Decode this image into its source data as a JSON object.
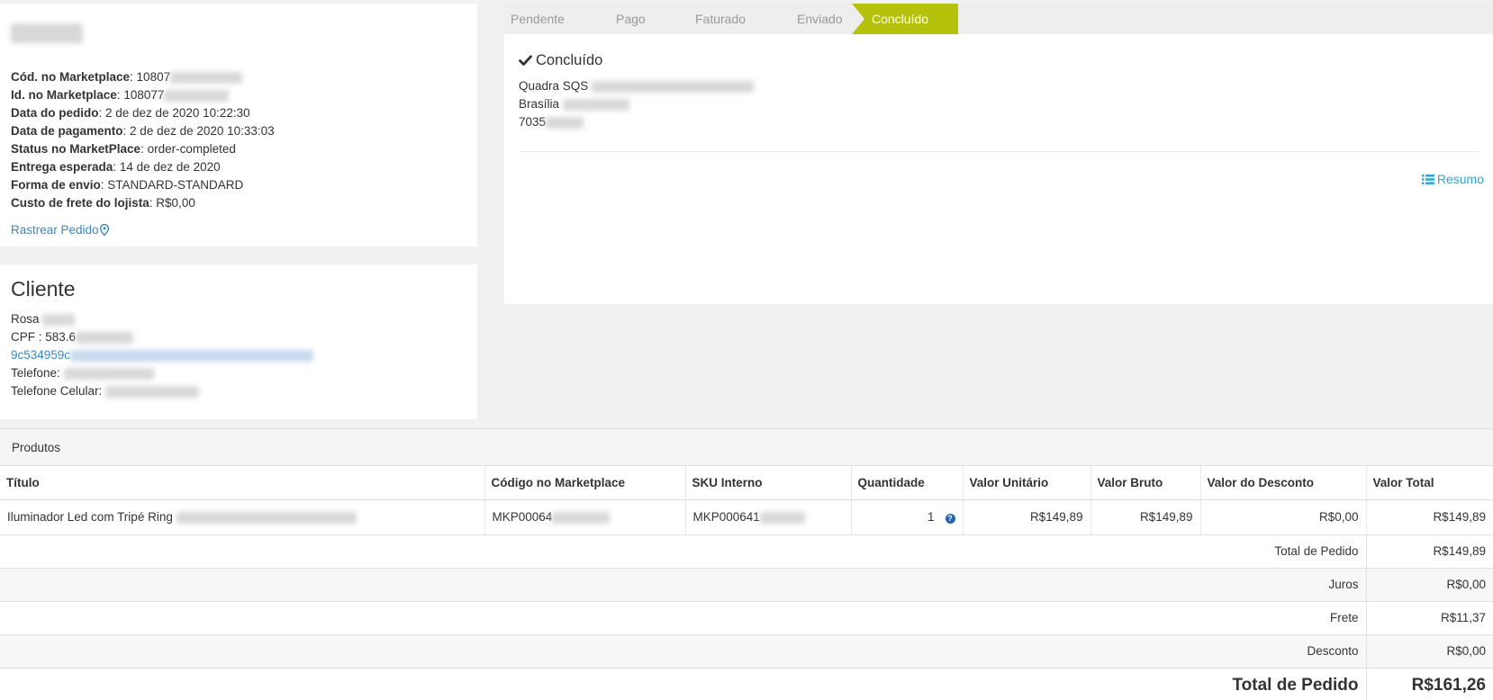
{
  "store": {
    "fields": [
      {
        "label": "Cód. no Marketplace",
        "value": "10807"
      },
      {
        "label": "Id. no Marketplace",
        "value": "108077"
      },
      {
        "label": "Data do pedido",
        "value": "2 de dez de 2020 10:22:30"
      },
      {
        "label": "Data de pagamento",
        "value": "2 de dez de 2020 10:33:03"
      },
      {
        "label": "Status no MarketPlace",
        "value": "order-completed"
      },
      {
        "label": "Entrega esperada",
        "value": "14 de dez de 2020"
      },
      {
        "label": "Forma de envio",
        "value": "STANDARD-STANDARD"
      },
      {
        "label": "Custo de frete do lojista",
        "value": "R$0,00"
      }
    ],
    "track_link": "Rastrear Pedido"
  },
  "client": {
    "title": "Cliente",
    "name": "Rosa",
    "cpf": "CPF : 583.6",
    "email": "9c534959c",
    "phone_label": "Telefone:",
    "mobile_label": "Telefone Celular:"
  },
  "status": {
    "steps": [
      "Pendente",
      "Pago",
      "Faturado",
      "Enviado",
      "Concluído"
    ],
    "active_step": "Concluído",
    "heading": "Concluído",
    "address": [
      "Quadra SQS",
      "Brasília",
      "7035"
    ],
    "summary_link": "Resumo",
    "accent_color": "#b4c20c"
  },
  "products": {
    "title": "Produtos",
    "columns": [
      "Título",
      "Código no Marketplace",
      "SKU Interno",
      "Quantidade",
      "Valor Unitário",
      "Valor Bruto",
      "Valor do Desconto",
      "Valor Total"
    ],
    "rows": [
      {
        "title": "Iluminador Led com Tripé Ring",
        "marketplace_code": "MKP00064",
        "sku": "MKP000641",
        "quantity": "1",
        "unit_value": "R$149,89",
        "gross_value": "R$149,89",
        "discount_value": "R$0,00",
        "total_value": "R$149,89"
      }
    ],
    "totals": [
      {
        "label": "Total de Pedido",
        "value": "R$149,89"
      },
      {
        "label": "Juros",
        "value": "R$0,00"
      },
      {
        "label": "Frete",
        "value": "R$11,37"
      },
      {
        "label": "Desconto",
        "value": "R$0,00"
      }
    ],
    "grand_total": {
      "label": "Total de Pedido",
      "value": "R$161,26"
    }
  }
}
